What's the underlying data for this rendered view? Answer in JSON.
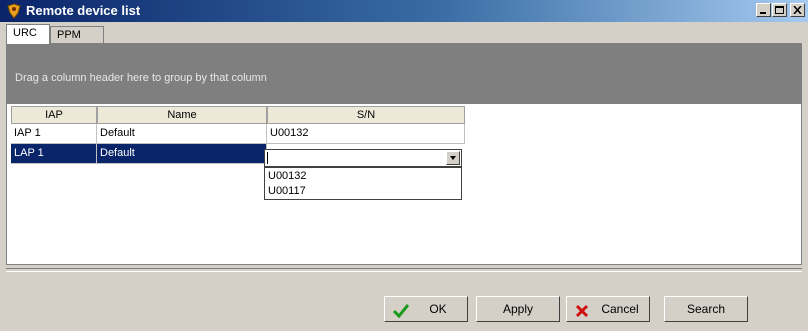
{
  "window": {
    "title": "Remote device list"
  },
  "tabs": [
    {
      "label": "URC",
      "active": true
    },
    {
      "label": "PPM",
      "active": false
    }
  ],
  "grid": {
    "group_hint": "Drag a column header here to group by that column",
    "columns": [
      "IAP",
      "Name",
      "S/N"
    ],
    "rows": [
      {
        "iap": "IAP 1",
        "name": "Default",
        "sn": "U00132",
        "selected": false
      },
      {
        "iap": "LAP 1",
        "name": "Default",
        "sn": "",
        "selected": true
      }
    ],
    "sn_dropdown_options": [
      "U00132",
      "U00117"
    ]
  },
  "buttons": {
    "ok": "OK",
    "apply": "Apply",
    "cancel": "Cancel",
    "search": "Search"
  },
  "colors": {
    "titlebar_start": "#0a246a",
    "selection": "#0a246a",
    "ok_icon": "#1a9a1a",
    "cancel_icon": "#d01010"
  }
}
